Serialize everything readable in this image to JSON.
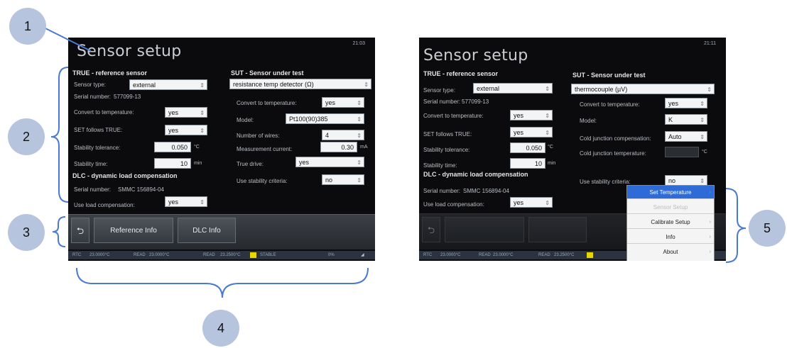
{
  "left_screen": {
    "title": "Sensor setup",
    "clock": "21:03",
    "true_section": {
      "heading": "TRUE - reference sensor",
      "sensor_type_label": "Sensor type:",
      "sensor_type_value": "external",
      "serial_label": "Serial number:",
      "serial_value": "577099-13",
      "convert_label": "Convert to temperature:",
      "convert_value": "yes",
      "set_follows_label": "SET follows TRUE:",
      "set_follows_value": "yes",
      "stability_tol_label": "Stability tolerance:",
      "stability_tol_value": "0.050",
      "stability_tol_unit": "°C",
      "stability_time_label": "Stability time:",
      "stability_time_value": "10",
      "stability_time_unit": "min"
    },
    "dlc_section": {
      "heading": "DLC - dynamic load compensation",
      "serial_label": "Serial number:",
      "serial_value": "SMMC 156894-04",
      "use_load_label": "Use load compensation:",
      "use_load_value": "yes"
    },
    "sut_section": {
      "heading": "SUT - Sensor under test",
      "type_value": "resistance temp detector (Ω)",
      "convert_label": "Convert to temperature:",
      "convert_value": "yes",
      "model_label": "Model:",
      "model_value": "Pt100(90)385",
      "wires_label": "Number of wires:",
      "wires_value": "4",
      "current_label": "Measurement current:",
      "current_value": "0.30",
      "current_unit": "mA",
      "true_drive_label": "True drive:",
      "true_drive_value": "yes",
      "stability_label": "Use stability criteria:",
      "stability_value": "no"
    },
    "toolbar": {
      "back_icon": "back-arrow-icon",
      "btn1": "Reference Info",
      "btn2": "DLC Info"
    },
    "status": {
      "s1": "RTC",
      "s2": "23.0000°C",
      "s3": "READ",
      "s4": "23.0000°C",
      "s5": "READ",
      "s6": "23.2500°C",
      "s7": "STABLE",
      "s8": "0%"
    }
  },
  "right_screen": {
    "title": "Sensor setup",
    "clock": "21:11",
    "true_section": {
      "heading": "TRUE - reference sensor",
      "sensor_type_label": "Sensor type:",
      "sensor_type_value": "external",
      "serial_label": "Serial number:",
      "serial_value": "577099-13",
      "convert_label": "Convert to temperature:",
      "convert_value": "yes",
      "set_follows_label": "SET follows TRUE:",
      "set_follows_value": "yes",
      "stability_tol_label": "Stability tolerance:",
      "stability_tol_value": "0.050",
      "stability_tol_unit": "°C",
      "stability_time_label": "Stability time:",
      "stability_time_value": "10",
      "stability_time_unit": "min"
    },
    "dlc_section": {
      "heading": "DLC - dynamic load compensation",
      "serial_label": "Serial number:",
      "serial_value": "SMMC 156894-04",
      "use_load_label": "Use load compensation:",
      "use_load_value": "yes"
    },
    "sut_section": {
      "heading": "SUT - Sensor under test",
      "type_value": "thermocouple (µV)",
      "convert_label": "Convert to temperature:",
      "convert_value": "yes",
      "model_label": "Model:",
      "model_value": "K",
      "cjc_label": "Cold junction compensation:",
      "cjc_value": "Auto",
      "cjt_label": "Cold junction temperature:",
      "cjt_unit": "°C",
      "stability_label": "Use stability criteria:",
      "stability_value": "no"
    },
    "status": {
      "s1": "RTC",
      "s2": "23.0000°C",
      "s3": "READ",
      "s4": "23.0000°C",
      "s5": "READ",
      "s6": "23.2500°C"
    },
    "menu": {
      "items": [
        "Set Temperature",
        "Sensor Setup",
        "Calibrate Setup",
        "Info",
        "About"
      ]
    }
  },
  "callouts": [
    "1",
    "2",
    "3",
    "4",
    "5"
  ]
}
